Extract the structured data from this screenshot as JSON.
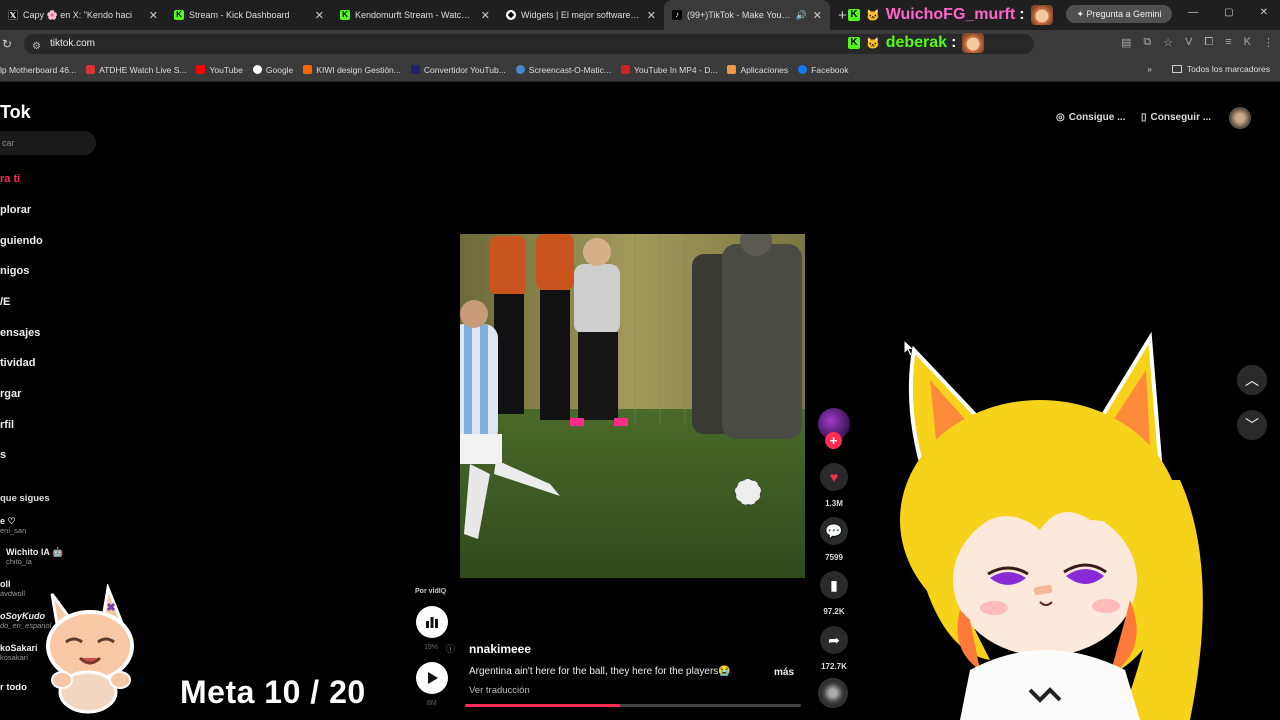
{
  "tabs": [
    {
      "title": "Capy 🌸 en X: \"Kendo haci",
      "favicon": "x",
      "active": false
    },
    {
      "title": "Stream - Kick Dashboard",
      "favicon": "kick",
      "active": false
    },
    {
      "title": "Kendomurft Stream - Watch Liv",
      "favicon": "kick",
      "active": false
    },
    {
      "title": "Widgets | El mejor software pa",
      "favicon": "widget",
      "active": false
    },
    {
      "title": "(99+)TikTok - Make Your Da",
      "favicon": "tiktok",
      "active": true
    }
  ],
  "gemini_label": "Pregunta a Gemini",
  "url": "tiktok.com",
  "bookmarks": [
    "lp Motherboard 46...",
    "ATDHE Watch Live S...",
    "YouTube",
    "Google",
    "KIWI design Gestión...",
    "Convertidor YouTub...",
    "Screencast-O-Matic...",
    "YouTube In MP4 - D...",
    "Aplicaciones",
    "Facebook"
  ],
  "bookmarks_all": "Todos los marcadores",
  "chat": [
    {
      "user": "WuichoFG_murft",
      "sep": ":",
      "color": "#ff66cc"
    },
    {
      "user": "deberak",
      "sep": ":",
      "color": "#53fc18"
    }
  ],
  "sidebar": {
    "logo": "Tok",
    "search_placeholder": "car",
    "nav": [
      "ra ti",
      "plorar",
      "guiendo",
      "nigos",
      "/E",
      "ensajes",
      "tividad",
      "rgar",
      "rfil",
      "s"
    ],
    "following_header": "que sigues",
    "following": [
      {
        "name": "e ♡",
        "handle": "eni_san"
      },
      {
        "name": "Wichito IA 🤖",
        "handle": "chito_ia"
      },
      {
        "name": "oll",
        "handle": "avdwoll"
      },
      {
        "name": "oSoyKudo",
        "handle": "do_en_espanol"
      },
      {
        "name": "koSakari",
        "handle": "kosakari"
      }
    ],
    "see_all": "r todo"
  },
  "topbar": {
    "coins_label": "Consigue ...",
    "app_label": "Conseguir ..."
  },
  "video": {
    "vidiq_label": "Por vidIQ",
    "vidiq_pct": "19%",
    "vidiq_sub": "8M",
    "author": "nnakimeee",
    "caption": "Argentina ain't here for the ball, they here for the players😭",
    "more": "más",
    "translate": "Ver traducción",
    "progress": 0.46
  },
  "actions": {
    "likes": "1.3M",
    "comments": "7599",
    "saves": "97.2K",
    "shares": "172.7K"
  },
  "overlay": {
    "meta": "Meta 10 / 20"
  },
  "colors": {
    "accent": "#fe2c55",
    "kick": "#53fc18"
  }
}
